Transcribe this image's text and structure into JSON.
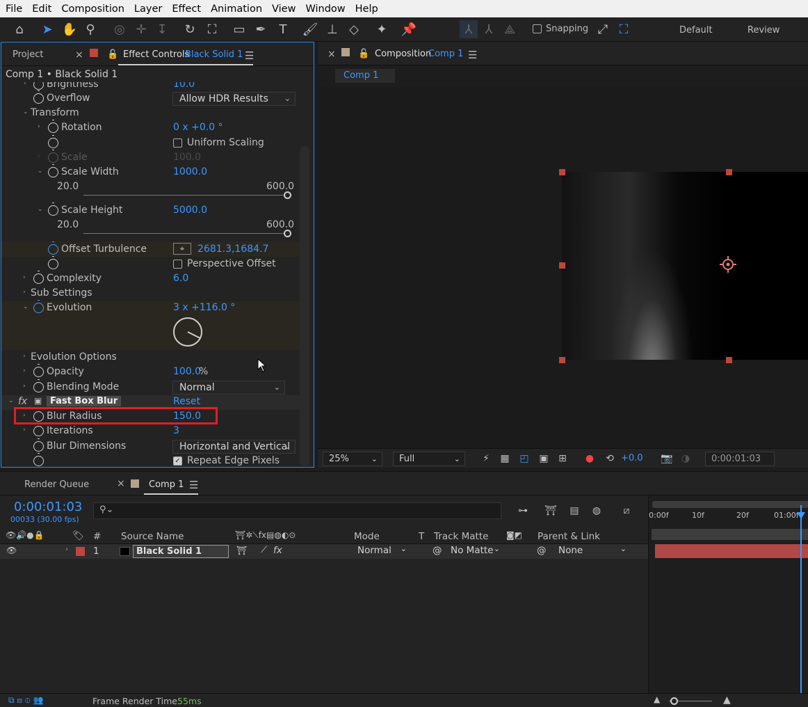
{
  "menu": [
    "File",
    "Edit",
    "Composition",
    "Layer",
    "Effect",
    "Animation",
    "View",
    "Window",
    "Help"
  ],
  "toolbar": {
    "snapping_label": "Snapping",
    "workspace_default": "Default",
    "workspace_review": "Review",
    "accent": "#3c98ff"
  },
  "effect_controls": {
    "project_tab": "Project",
    "tab_label": "Effect Controls",
    "tab_layer": "Black Solid 1",
    "subtitle": "Comp 1 • Black Solid 1",
    "rows": {
      "brightness_label": "Brightness",
      "brightness_value": "10.0",
      "overflow_label": "Overflow",
      "overflow_value": "Allow HDR Results",
      "transform_label": "Transform",
      "rotation_label": "Rotation",
      "rotation_value": "0 x +0.0 °",
      "uniform_scaling_label": "Uniform Scaling",
      "scale_label": "Scale",
      "scale_value": "100.0",
      "scale_width_label": "Scale Width",
      "scale_width_value": "1000.0",
      "sw_min": "20.0",
      "sw_max": "600.0",
      "scale_height_label": "Scale Height",
      "scale_height_value": "5000.0",
      "sh_min": "20.0",
      "sh_max": "600.0",
      "offset_label": "Offset Turbulence",
      "offset_value": "2681.3,1684.7",
      "perspective_label": "Perspective Offset",
      "complexity_label": "Complexity",
      "complexity_value": "6.0",
      "sub_settings_label": "Sub Settings",
      "evolution_label": "Evolution",
      "evolution_value": "3 x +116.0 °",
      "evolution_options_label": "Evolution Options",
      "opacity_label": "Opacity",
      "opacity_value": "100.0",
      "opacity_unit": "%",
      "blending_label": "Blending Mode",
      "blending_value": "Normal",
      "fx_label": "Fast Box Blur",
      "reset_label": "Reset",
      "blur_radius_label": "Blur Radius",
      "blur_radius_value": "150.0",
      "iterations_label": "Iterations",
      "iterations_value": "3",
      "blur_dimensions_label": "Blur Dimensions",
      "blur_dimensions_value": "Horizontal and Vertical",
      "repeat_edge_label": "Repeat Edge Pixels"
    }
  },
  "composition": {
    "tab_label": "Composition",
    "tab_comp": "Comp 1",
    "sub_tab": "Comp 1",
    "zoom": "25%",
    "resolution": "Full",
    "exposure": "+0.0",
    "timecode": "0:00:01:03"
  },
  "timeline": {
    "render_queue_tab": "Render Queue",
    "comp_tab": "Comp 1",
    "timecode": "0:00:01:03",
    "fps": "00033 (30.00 fps)",
    "search_icon": "search-icon",
    "columns": {
      "num": "#",
      "source_name": "Source Name",
      "mode": "Mode",
      "t": "T",
      "track_matte": "Track Matte",
      "parent": "Parent & Link"
    },
    "layer": {
      "number": "1",
      "name": "Black Solid 1",
      "mode": "Normal",
      "matte": "No Matte",
      "parent": "None",
      "label_color": "#c0453d"
    },
    "ruler": [
      "0:00f",
      "10f",
      "20f",
      "01:00f"
    ]
  },
  "status": {
    "frame_render_label": "Frame Render Time:",
    "frame_render_value": "55ms"
  }
}
